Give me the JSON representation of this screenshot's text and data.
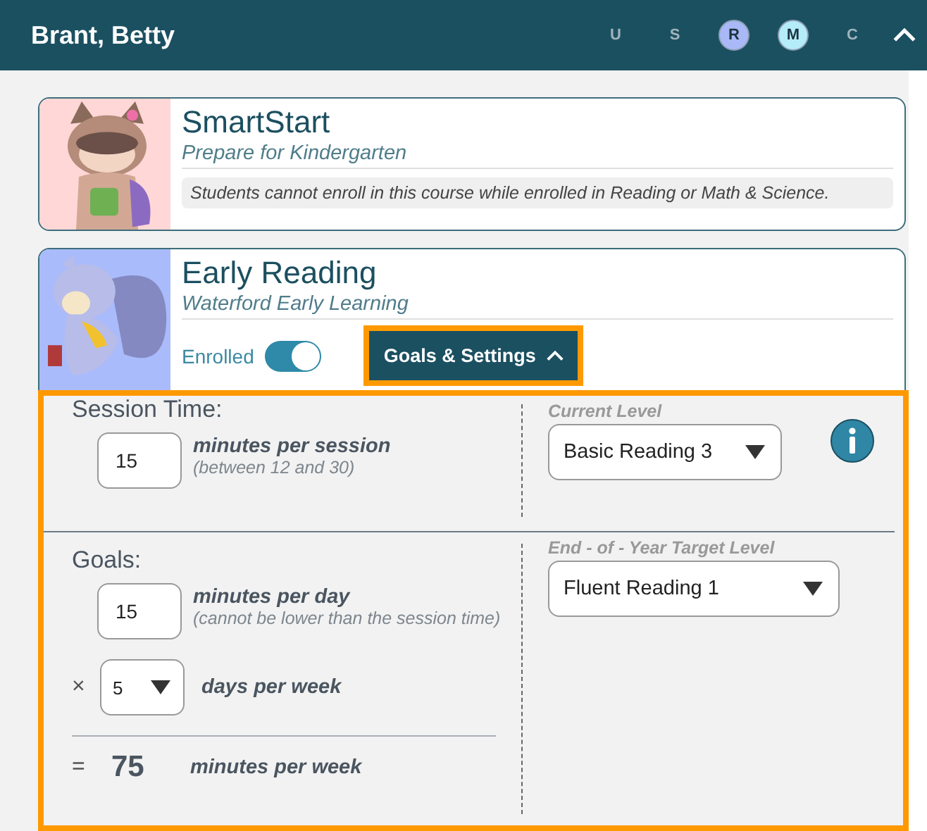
{
  "header": {
    "student_name": "Brant, Betty",
    "expanded": true,
    "programs": [
      {
        "letter": "U",
        "enrolled": false
      },
      {
        "letter": "S",
        "enrolled": false
      },
      {
        "letter": "R",
        "enrolled": true,
        "color": "#a9b8f7"
      },
      {
        "letter": "M",
        "enrolled": true,
        "color": "#b5ecfa"
      },
      {
        "letter": "C",
        "enrolled": false
      }
    ]
  },
  "courses": [
    {
      "kind": "locked",
      "title": "SmartStart",
      "subtitle": "Prepare for Kindergarten",
      "color": "#ffd7d7",
      "note": "Students cannot enroll in this course while enrolled in Reading or Math & Science."
    },
    {
      "kind": "enrollable",
      "title": "Early Reading",
      "subtitle": "Waterford Early Learning",
      "color": "#aabbfb",
      "enrolled_label": "Enrolled",
      "enrolled": true,
      "settings_button": {
        "label": "Goals & Settings",
        "expanded": true
      }
    }
  ],
  "settings": {
    "session_time": {
      "heading": "Session Time:",
      "value": "15",
      "label": "minutes per session",
      "hint": "(between 12 and 30)"
    },
    "current_level": {
      "label": "Current Level",
      "value": "Basic Reading 3"
    },
    "goals": {
      "heading": "Goals:",
      "minutes_per_day": {
        "value": "15",
        "label": "minutes per day",
        "hint": "(cannot be lower than the session time)"
      },
      "times": "×",
      "days": {
        "value": "5",
        "label": "days per week"
      },
      "equals": "=",
      "total": "75",
      "total_label": "minutes per week"
    },
    "target_level": {
      "label": "End - of - Year Target Level",
      "value": "Fluent Reading 1"
    }
  }
}
